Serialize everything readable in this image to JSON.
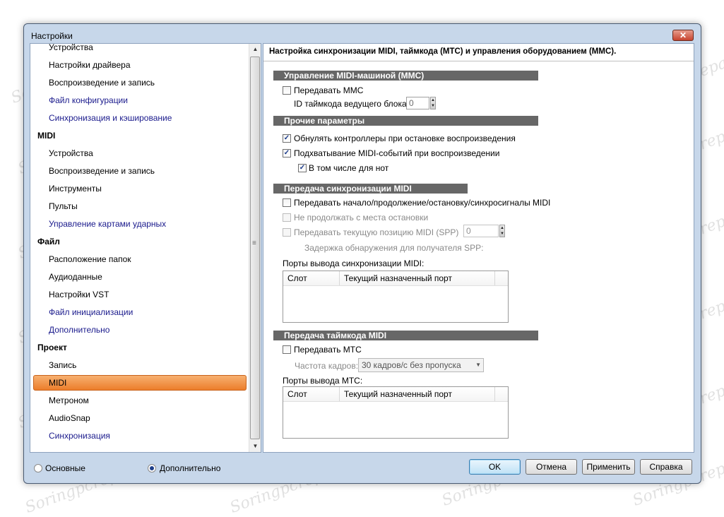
{
  "window": {
    "title": "Настройки",
    "close_label": "✕"
  },
  "tree": {
    "items": [
      {
        "label": "Устройства",
        "level": "sub",
        "color": "default"
      },
      {
        "label": "Настройки драйвера",
        "level": "sub",
        "color": "default"
      },
      {
        "label": "Воспроизведение и запись",
        "level": "sub",
        "color": "default"
      },
      {
        "label": "Файл конфигурации",
        "level": "sub",
        "color": "blue"
      },
      {
        "label": "Синхронизация и кэширование",
        "level": "sub",
        "color": "blue"
      },
      {
        "label": "MIDI",
        "level": "cat",
        "color": "default"
      },
      {
        "label": "Устройства",
        "level": "sub",
        "color": "default"
      },
      {
        "label": "Воспроизведение и запись",
        "level": "sub",
        "color": "default"
      },
      {
        "label": "Инструменты",
        "level": "sub",
        "color": "default"
      },
      {
        "label": "Пульты",
        "level": "sub",
        "color": "default"
      },
      {
        "label": "Управление картами ударных",
        "level": "sub",
        "color": "blue"
      },
      {
        "label": "Файл",
        "level": "cat",
        "color": "default"
      },
      {
        "label": "Расположение папок",
        "level": "sub",
        "color": "default"
      },
      {
        "label": "Аудиоданные",
        "level": "sub",
        "color": "default"
      },
      {
        "label": "Настройки VST",
        "level": "sub",
        "color": "default"
      },
      {
        "label": "Файл инициализации",
        "level": "sub",
        "color": "blue"
      },
      {
        "label": "Дополнительно",
        "level": "sub",
        "color": "blue"
      },
      {
        "label": "Проект",
        "level": "cat",
        "color": "default"
      },
      {
        "label": "Запись",
        "level": "sub",
        "color": "default"
      },
      {
        "label": "MIDI",
        "level": "sub",
        "color": "default",
        "selected": true
      },
      {
        "label": "Метроном",
        "level": "sub",
        "color": "default"
      },
      {
        "label": "AudioSnap",
        "level": "sub",
        "color": "default"
      },
      {
        "label": "Синхронизация",
        "level": "sub",
        "color": "blue"
      }
    ],
    "scroll_mid_glyph": "≡"
  },
  "panel": {
    "header": "Настройка синхронизации MIDI, таймкода (MTC) и управления оборудованием (MMC).",
    "mmc": {
      "title": "Управление MIDI-машиной (MMC)",
      "send_mmc": "Передавать MMC",
      "device_id_label": "ID таймкода ведущего блока:",
      "device_id_value": "0"
    },
    "other": {
      "title": "Прочие параметры",
      "zero_controllers": "Обнулять контроллеры при остановке воспроизведения",
      "chase_events": "Подхватывание MIDI-событий при воспроизведении",
      "include_notes": "В том числе для нот"
    },
    "midi_sync": {
      "title": "Передача синхронизации MIDI",
      "send_start_stop": "Передавать начало/продолжение/остановку/синхросигналы MIDI",
      "no_continue": "Не продолжать с места остановки",
      "send_spp": "Передавать текущую позицию MIDI (SPP)",
      "spp_value": "0",
      "spp_delay": "Задержка обнаружения для получателя SPP:",
      "ports_label": "Порты вывода синхронизации MIDI:",
      "col_slot": "Слот",
      "col_port": "Текущий назначенный порт"
    },
    "mtc": {
      "title": "Передача таймкода MIDI",
      "send_mtc": "Передавать MTC",
      "frame_rate_label": "Частота кадров:",
      "frame_rate_value": "30 кадров/с без пропуска",
      "ports_label": "Порты вывода MTC:",
      "col_slot": "Слот",
      "col_port": "Текущий назначенный порт"
    }
  },
  "footer": {
    "radio_basic": "Основные",
    "radio_advanced": "Дополнительно",
    "ok": "OK",
    "cancel": "Отмена",
    "apply": "Применить",
    "help": "Справка"
  },
  "checkbox_states": {
    "send_mmc": false,
    "zero_controllers": true,
    "chase_events": true,
    "include_notes": true,
    "send_start_stop": false,
    "no_continue": false,
    "send_spp": false,
    "send_mtc": false
  },
  "watermark": "Soringpcrepair.com",
  "colors": {
    "selection": "#ec7d2a",
    "section_bar": "#676767",
    "link_blue": "#1a1a8c"
  }
}
